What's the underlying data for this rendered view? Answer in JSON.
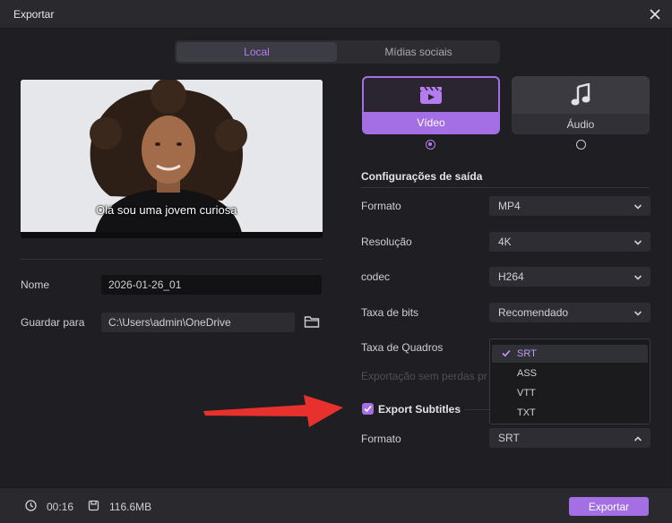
{
  "window": {
    "title": "Exportar"
  },
  "tabs": [
    {
      "label": "Local",
      "active": true
    },
    {
      "label": "Mídias sociais",
      "active": false
    }
  ],
  "preview": {
    "subtitle": "Olá  sou uma jovem curiosa"
  },
  "form": {
    "name_label": "Nome",
    "name_value": "2026-01-26_01",
    "save_label": "Guardar para",
    "save_path": "C:\\Users\\admin\\OneDrive"
  },
  "media_types": [
    {
      "label": "Vídeo",
      "icon": "video-clapper-icon",
      "selected": true
    },
    {
      "label": "Áudio",
      "icon": "music-note-icon",
      "selected": false
    }
  ],
  "output": {
    "section_title": "Configurações de saída",
    "rows": [
      {
        "label": "Formato",
        "value": "MP4"
      },
      {
        "label": "Resolução",
        "value": "4K"
      },
      {
        "label": "codec",
        "value": "H264"
      },
      {
        "label": "Taxa de bits",
        "value": "Recomendado"
      },
      {
        "label": "Taxa de Quadros"
      }
    ],
    "lossless_label": "Exportação sem perdas pr",
    "export_subtitles_label": "Export Subtitles",
    "export_subtitles_checked": true,
    "subtitle_format_label": "Formato",
    "subtitle_format_value": "SRT",
    "subtitle_format_options": [
      "SRT",
      "ASS",
      "VTT",
      "TXT"
    ],
    "subtitle_format_selected": "SRT"
  },
  "footer": {
    "duration": "00:16",
    "size": "116.6MB",
    "export_label": "Exportar"
  },
  "colors": {
    "accent": "#a46fe4",
    "accent_text": "#b57cf0",
    "arrow": "#e8302c",
    "background": "#1f1f23"
  }
}
